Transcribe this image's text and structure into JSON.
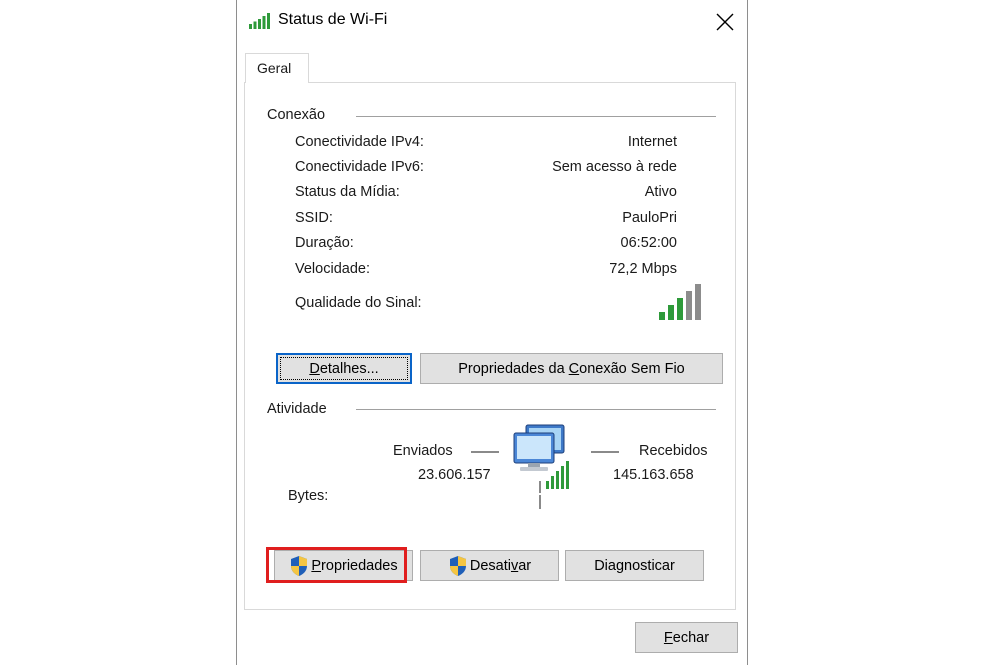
{
  "window": {
    "title": "Status de Wi-Fi",
    "close_glyph": "close-icon"
  },
  "tabs": [
    {
      "label": "Geral"
    }
  ],
  "connection": {
    "section_title": "Conexão",
    "rows": [
      {
        "label": "Conectividade IPv4:",
        "value": "Internet"
      },
      {
        "label": "Conectividade IPv6:",
        "value": "Sem acesso à rede"
      },
      {
        "label": "Status da Mídia:",
        "value": "Ativo"
      },
      {
        "label": "SSID:",
        "value": "PauloPri"
      },
      {
        "label": "Duração:",
        "value": "06:52:00"
      },
      {
        "label": "Velocidade:",
        "value": "72,2 Mbps"
      }
    ],
    "signal_label": "Qualidade do Sinal:",
    "signal_bars_active": 3,
    "signal_bars_total": 5
  },
  "buttons": {
    "details": {
      "pre": "",
      "mn": "D",
      "post": "etalhes..."
    },
    "wireless_props": {
      "pre": "Propriedades da ",
      "mn": "C",
      "post": "onexão Sem Fio"
    },
    "properties": {
      "pre": "",
      "mn": "P",
      "post": "ropriedades"
    },
    "disable": {
      "pre": "Desati",
      "mn": "v",
      "post": "ar"
    },
    "diagnose": {
      "pre": "Dia",
      "mn": "g",
      "post": "nosticar"
    },
    "close": {
      "pre": "",
      "mn": "F",
      "post": "echar"
    }
  },
  "activity": {
    "section_title": "Atividade",
    "sent_label": "Enviados",
    "received_label": "Recebidos",
    "bytes_label": "Bytes:",
    "bytes_sent": "23.606.157",
    "bytes_received": "145.163.658"
  },
  "colors": {
    "highlight": "#e01e1e",
    "focus": "#0a64c8",
    "signal_green": "#2e9a3a"
  }
}
